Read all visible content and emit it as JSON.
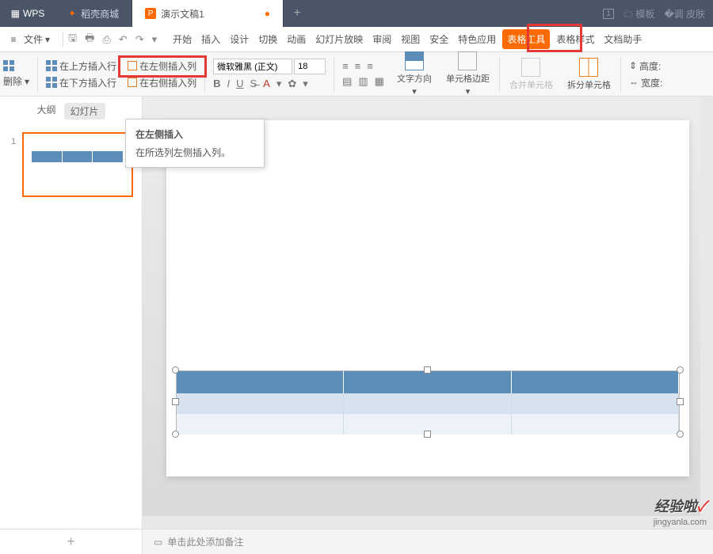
{
  "titlebar": {
    "app": "WPS",
    "tab_store": "稻壳商城",
    "tab_doc": "演示文稿1",
    "badge": "1",
    "template": "模板",
    "skin": "皮肤"
  },
  "menu": {
    "file": "文件",
    "tabs": [
      "开始",
      "插入",
      "设计",
      "切换",
      "动画",
      "幻灯片放映",
      "审阅",
      "视图",
      "安全",
      "特色应用"
    ],
    "table_tools": "表格工具",
    "table_style": "表格样式",
    "doc_helper": "文档助手"
  },
  "ribbon": {
    "delete": "删除",
    "insert_above": "在上方插入行",
    "insert_below": "在下方插入行",
    "insert_left": "在左侧插入列",
    "insert_right": "在右侧插入列",
    "font_name": "微软雅黑 (正文)",
    "font_size": "18",
    "text_dir": "文字方向",
    "cell_margin": "单元格边距",
    "merge": "合并单元格",
    "split": "拆分单元格",
    "height": "高度:",
    "width": "宽度:"
  },
  "tooltip": {
    "title": "在左侧插入",
    "desc": "在所选列左侧插入列。"
  },
  "pane": {
    "outline": "大纲",
    "slides": "幻灯片",
    "slide_num": "1"
  },
  "notes": {
    "placeholder": "单击此处添加备注"
  },
  "watermark": {
    "text": "经验啦",
    "sub": "jingyanla.com"
  }
}
